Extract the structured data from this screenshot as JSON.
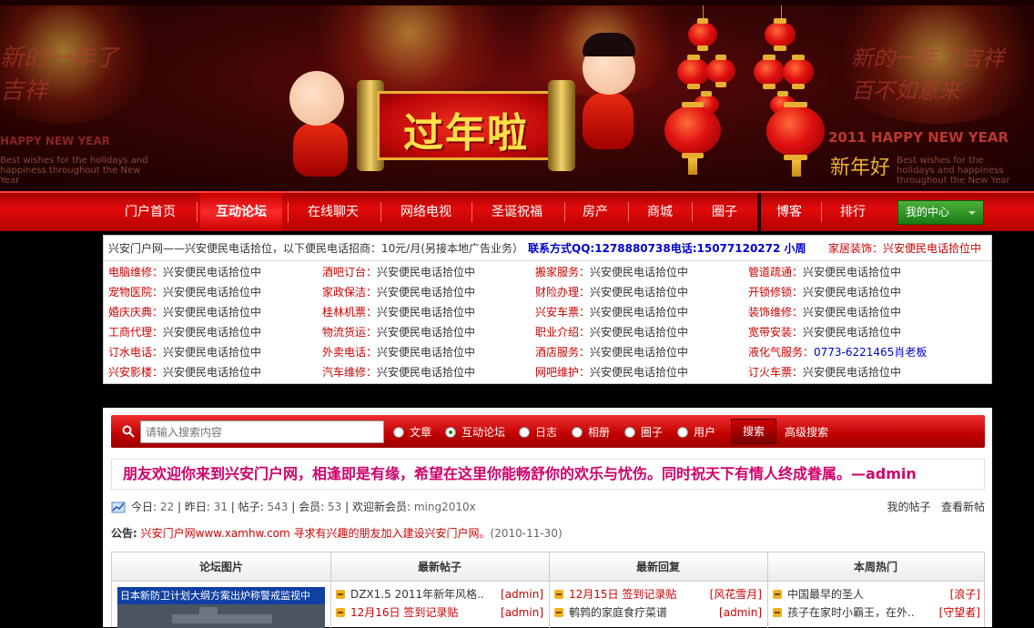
{
  "banner": {
    "title": "过年啦",
    "left_script": "新的一年了吉祥",
    "right_script": "新的一年了吉祥 百不如意来",
    "happy_left": "HAPPY NEW YEAR",
    "happy_right": "2011 HAPPY NEW YEAR",
    "new_year": "新年好",
    "wishes_left": "Best wishes for the holidays and happiness throughout the New Year",
    "wishes_right": "Best wishes for the holidays and happiness throughout the New Year"
  },
  "nav": {
    "items": [
      "门户首页",
      "互动论坛",
      "在线聊天",
      "网络电视",
      "圣诞祝福",
      "房产",
      "商城",
      "圈子",
      "博客",
      "排行"
    ],
    "my_center": "我的中心"
  },
  "info": {
    "main": "兴安门户网——兴安便民电话拾位，以下便民电话招商：10元/月(另接本地广告业务）",
    "contact": "联系方式QQ:1278880738电话:15077120272 小周",
    "home": "家居装饰：兴安便民电话拾位中",
    "services": [
      [
        {
          "k": "电脑维修：",
          "v": "兴安便民电话拾位中"
        },
        {
          "k": "酒吧订台：",
          "v": "兴安便民电话拾位中"
        },
        {
          "k": "搬家服务：",
          "v": "兴安便民电话拾位中"
        },
        {
          "k": "管道疏通：",
          "v": "兴安便民电话拾位中"
        }
      ],
      [
        {
          "k": "宠物医院：",
          "v": "兴安便民电话拾位中"
        },
        {
          "k": "家政保洁：",
          "v": "兴安便民电话拾位中"
        },
        {
          "k": "财险办理：",
          "v": "兴安便民电话拾位中"
        },
        {
          "k": "开锁修锁：",
          "v": "兴安便民电话拾位中"
        }
      ],
      [
        {
          "k": "婚庆庆典：",
          "v": "兴安便民电话拾位中"
        },
        {
          "k": "桂林机票：",
          "v": "兴安便民电话拾位中"
        },
        {
          "k": "兴安车票：",
          "v": "兴安便民电话拾位中"
        },
        {
          "k": "装饰维修：",
          "v": "兴安便民电话拾位中"
        }
      ],
      [
        {
          "k": "工商代理：",
          "v": "兴安便民电话拾位中"
        },
        {
          "k": "物流货运：",
          "v": "兴安便民电话拾位中"
        },
        {
          "k": "职业介绍：",
          "v": "兴安便民电话拾位中"
        },
        {
          "k": "宽带安装：",
          "v": "兴安便民电话拾位中"
        }
      ],
      [
        {
          "k": "订水电话：",
          "v": "兴安便民电话拾位中"
        },
        {
          "k": "外卖电话：",
          "v": "兴安便民电话拾位中"
        },
        {
          "k": "酒店服务：",
          "v": "兴安便民电话拾位中"
        },
        {
          "k": "液化气服务：",
          "v": "0773-6221465肖老板"
        }
      ],
      [
        {
          "k": "兴安影楼：",
          "v": "兴安便民电话拾位中"
        },
        {
          "k": "汽车维修：",
          "v": "兴安便民电话拾位中"
        },
        {
          "k": "网吧维护：",
          "v": "兴安便民电话拾位中"
        },
        {
          "k": "订火车票：",
          "v": "兴安便民电话拾位中"
        }
      ]
    ]
  },
  "search": {
    "placeholder": "请输入搜索内容",
    "options": [
      "文章",
      "互动论坛",
      "日志",
      "相册",
      "圈子",
      "用户"
    ],
    "selected": "互动论坛",
    "button": "搜索",
    "advanced": "高级搜索"
  },
  "welcome": "朋友欢迎你来到兴安门户网，相逢即是有缘，希望在这里你能畅舒你的欢乐与忧伤。同时祝天下有情人终成眷属。—admin",
  "stats": {
    "today_label": "今日:",
    "today": "22",
    "yesterday_label": "昨日:",
    "yesterday": "31",
    "posts_label": "帖子:",
    "posts": "543",
    "members_label": "会员:",
    "members": "53",
    "newmember_label": "欢迎新会员:",
    "newmember": "ming2010x",
    "my_posts": "我的帖子",
    "view_new": "查看新帖"
  },
  "notice": {
    "label": "公告:",
    "text": "兴安门户网www.xamhw.com 寻求有兴趣的朋友加入建设兴安门户网。",
    "date": "(2010-11-30)"
  },
  "grid": {
    "headers": [
      "论坛图片",
      "最新帖子",
      "最新回复",
      "本周热门"
    ],
    "pic_caption": "日本新防卫计划大纲方案出炉称警戒监视中",
    "latest_posts": [
      {
        "title": "DZX1.5 2011年新年风格..",
        "author": "[admin]"
      },
      {
        "title": "12月16日  签到记录贴",
        "author": "[admin]"
      }
    ],
    "latest_replies": [
      {
        "title": "12月15日  签到记录贴",
        "author": "[风花雪月]"
      },
      {
        "title": "鹌鹑的家庭食疗菜谱",
        "author": "[admin]"
      }
    ],
    "weekly_hot": [
      {
        "title": "中国最早的圣人",
        "author": "[浪子]"
      },
      {
        "title": "孩子在家时小霸王，在外..",
        "author": "[守望者]"
      }
    ]
  }
}
